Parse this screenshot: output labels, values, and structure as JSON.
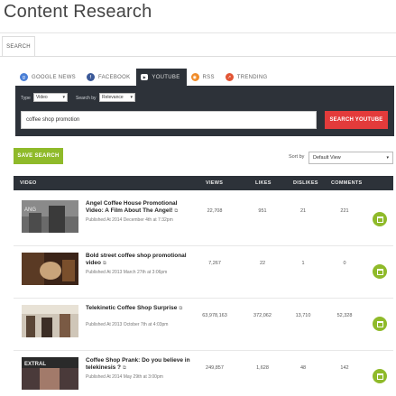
{
  "page": {
    "title": "Content Research",
    "outer_tab": "SEARCH"
  },
  "tabs": [
    {
      "label": "GOOGLE NEWS",
      "icon": "google-icon"
    },
    {
      "label": "FACEBOOK",
      "icon": "facebook-icon"
    },
    {
      "label": "YOUTUBE",
      "icon": "youtube-icon",
      "active": true
    },
    {
      "label": "RSS",
      "icon": "rss-icon"
    },
    {
      "label": "TRENDING",
      "icon": "trending-icon"
    }
  ],
  "filters": {
    "type_label": "Type",
    "type_value": "Video",
    "sort_label": "Search by",
    "sort_value": "Relevance"
  },
  "search": {
    "value": "coffee shop promotion",
    "button": "SEARCH YOUTUBE"
  },
  "toolbar": {
    "save": "SAVE SEARCH",
    "sort_label": "Sort by",
    "sort_value": "Default View"
  },
  "table": {
    "headers": {
      "video": "VIDEO",
      "views": "VIEWS",
      "likes": "LIKES",
      "dislikes": "DISLIKES",
      "comments": "COMMENTS"
    },
    "rows": [
      {
        "title": "Angel Coffee House Promotional Video: A Film About The Angel!",
        "published": "Published At 2014 December 4th at 7:32pm",
        "views": "22,708",
        "likes": "951",
        "dislikes": "21",
        "comments": "221"
      },
      {
        "title": "Bold street coffee shop promotional video",
        "published": "Published At 2013 March 27th at 3:06pm",
        "views": "7,267",
        "likes": "22",
        "dislikes": "1",
        "comments": "0"
      },
      {
        "title": "Telekinetic Coffee Shop Surprise",
        "published": "Published At 2013 October 7th at 4:03pm",
        "views": "63,978,163",
        "likes": "372,062",
        "dislikes": "13,710",
        "comments": "52,328"
      },
      {
        "title": "Coffee Shop Prank: Do you believe in telekinesis ?",
        "published": "Published At 2014 May 29th at 3:00pm",
        "views": "249,857",
        "likes": "1,628",
        "dislikes": "48",
        "comments": "142"
      }
    ]
  },
  "colors": {
    "dark": "#2d3239",
    "accent_red": "#e33b3b",
    "accent_green": "#8fba2a"
  }
}
